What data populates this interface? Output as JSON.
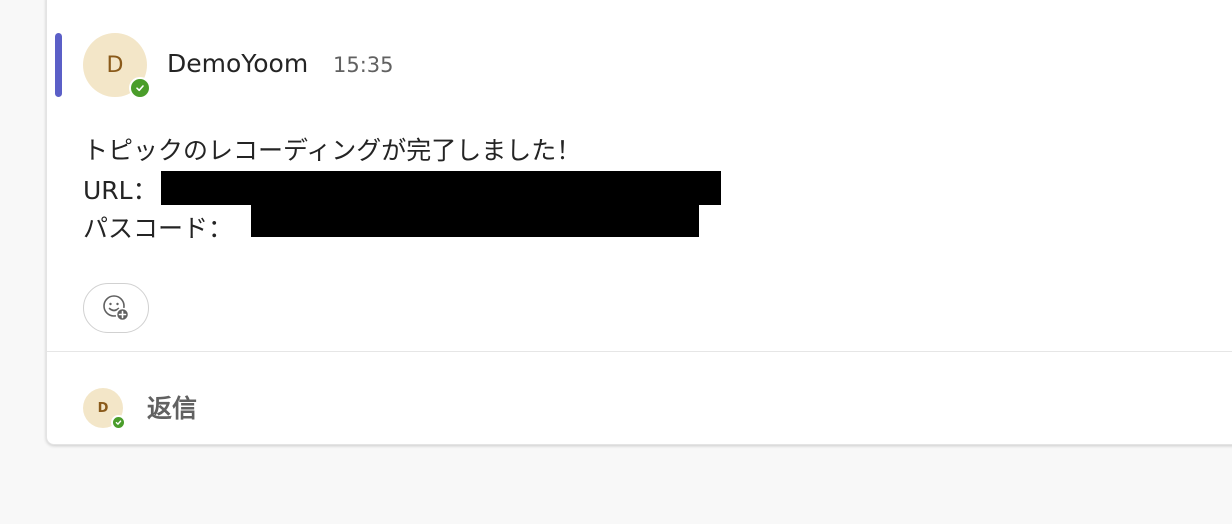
{
  "message": {
    "author": "DemoYoom",
    "time": "15:35",
    "avatar_initial": "D",
    "presence": "available",
    "body_lines": [
      "トピックのレコーディングが完了しました！",
      "URL：",
      "パスコード："
    ]
  },
  "reaction_button": {
    "icon": "emoji-add-icon"
  },
  "reply": {
    "avatar_initial": "D",
    "label": "返信"
  },
  "colors": {
    "accent": "#5b5fc7",
    "presence": "#4a9d2a",
    "avatar_bg": "#f3e6c8"
  }
}
